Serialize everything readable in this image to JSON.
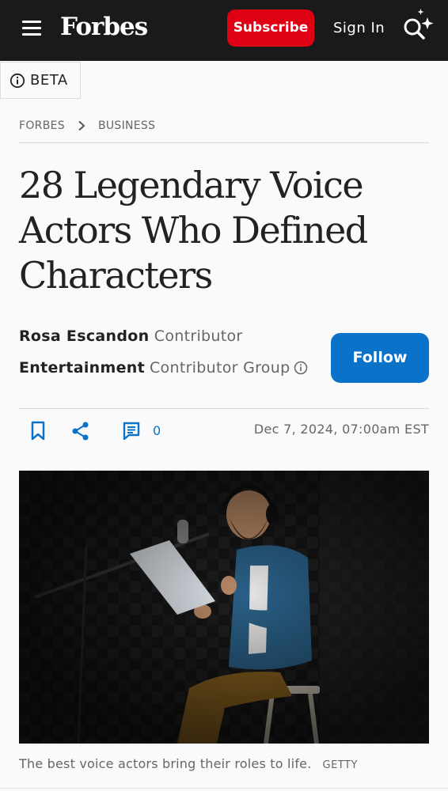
{
  "header": {
    "logo": "Forbes",
    "subscribe_label": "Subscribe",
    "signin_label": "Sign In",
    "icons": [
      "menu-icon",
      "sparkle-search-icon"
    ]
  },
  "beta": {
    "label": "BETA"
  },
  "breadcrumb": {
    "items": [
      "FORBES",
      "BUSINESS"
    ]
  },
  "article": {
    "title_lines": [
      "28 Legendary Voice",
      "Actors Who Defined",
      "Characters"
    ],
    "author": {
      "name": "Rosa Escandon",
      "role": "Contributor"
    },
    "group": {
      "name": "Entertainment",
      "role": "Contributor Group"
    },
    "follow_label": "Follow",
    "comment_count": "0",
    "date": "Dec 7, 2024, 07:00am EST",
    "image_caption": "The best voice actors bring their roles to life.",
    "image_credit": "GETTY"
  },
  "colors": {
    "brand_red": "#e00014",
    "accent_blue": "#0b72c9",
    "header_bg": "#1a1a1a"
  }
}
